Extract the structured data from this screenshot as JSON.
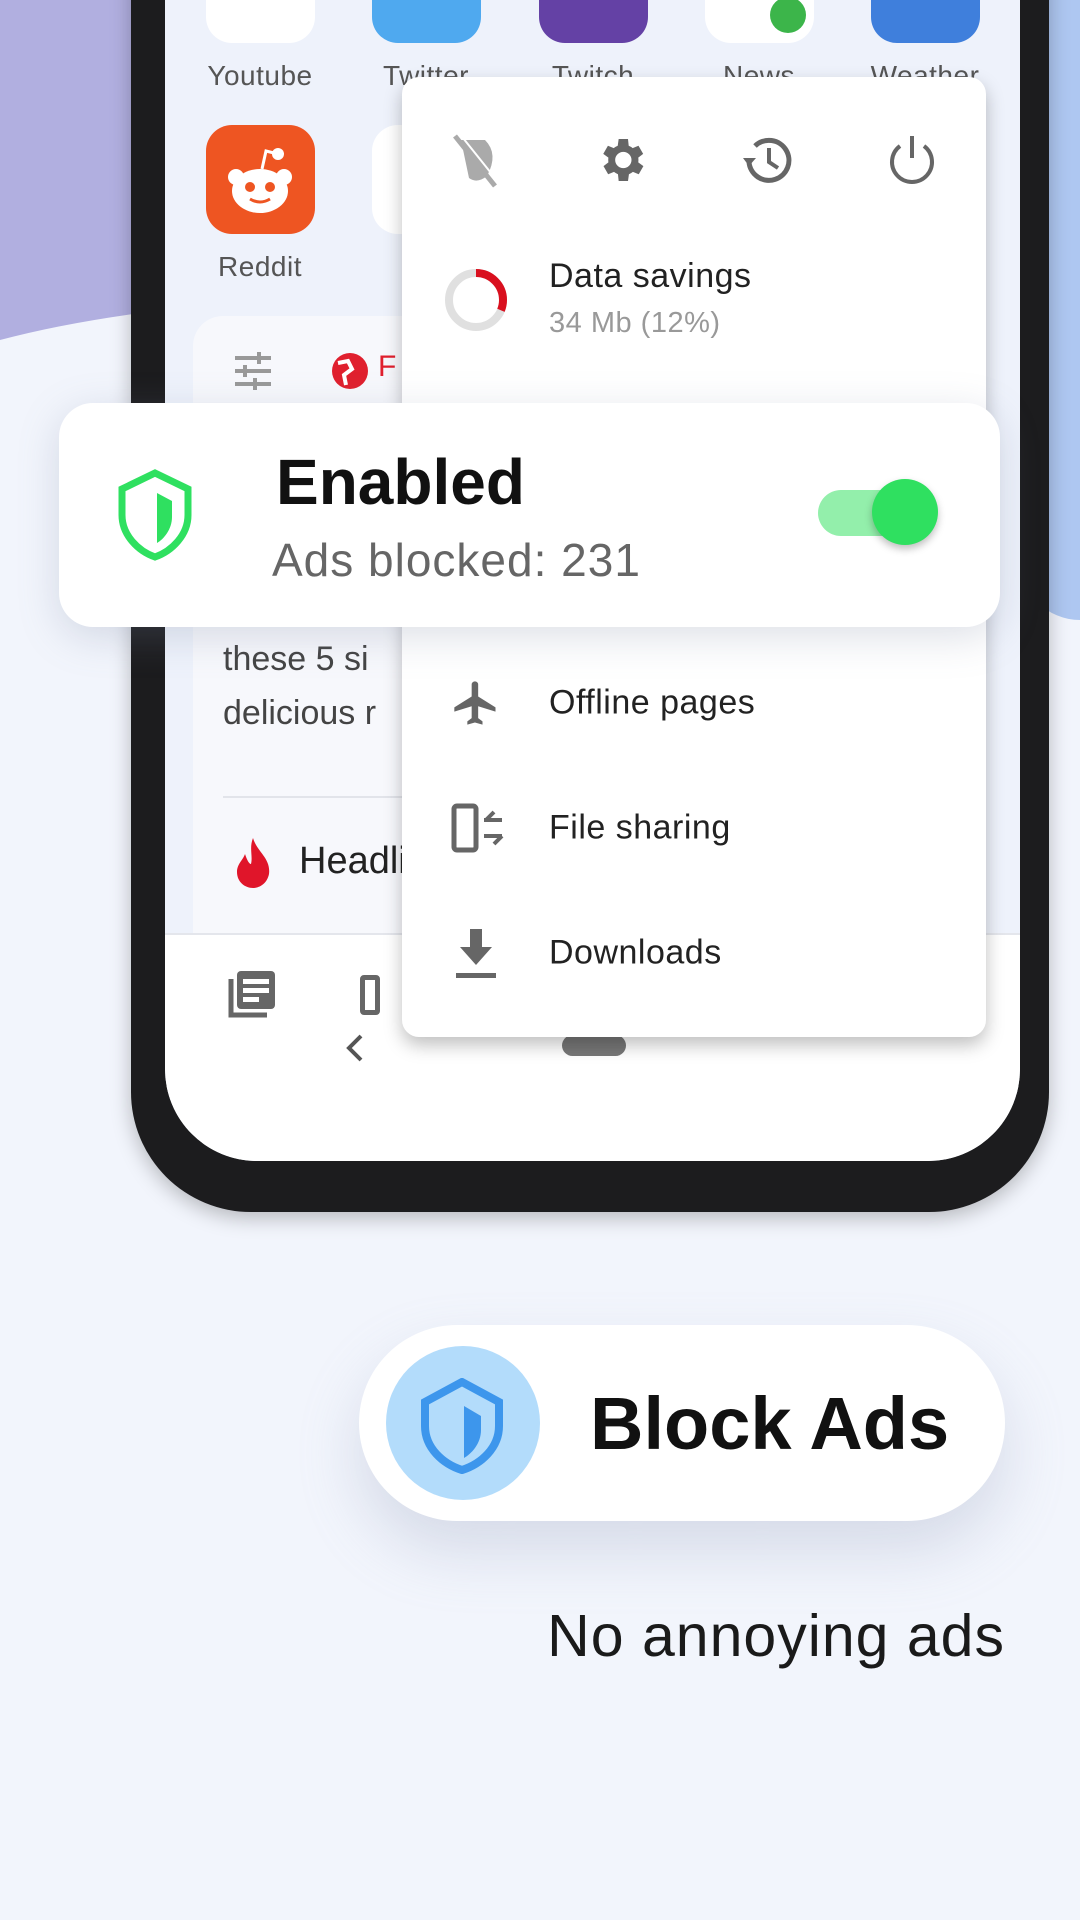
{
  "apps": [
    {
      "label": "Youtube",
      "color": "#ffffff"
    },
    {
      "label": "Twitter",
      "color": "#4fa9ef"
    },
    {
      "label": "Twitch",
      "color": "#6441a5"
    },
    {
      "label": "News",
      "color": "#ffffff"
    },
    {
      "label": "Weather",
      "color": "#3f7fdc"
    },
    {
      "label": "Reddit",
      "color": "#ee5522"
    }
  ],
  "feed": {
    "tab_partial": "F",
    "line1": "these 5 si",
    "line2": "delicious r",
    "headlines": "Headli"
  },
  "menu": {
    "top_icons": [
      "ad-block-off-icon",
      "settings-icon",
      "history-icon",
      "power-icon"
    ],
    "data_savings": {
      "title": "Data savings",
      "value": "34 Mb (12%)",
      "percent": 12
    },
    "items": [
      {
        "label": "Offline pages",
        "icon": "airplane-icon"
      },
      {
        "label": "File sharing",
        "icon": "file-sharing-icon"
      },
      {
        "label": "Downloads",
        "icon": "download-icon"
      }
    ]
  },
  "adblock": {
    "status": "Enabled",
    "count_label": "Ads blocked: 231",
    "enabled": true,
    "accent": "#2fe060"
  },
  "promo": {
    "title": "Block Ads",
    "subtitle": "No annoying ads",
    "accent": "#3d96ec"
  }
}
